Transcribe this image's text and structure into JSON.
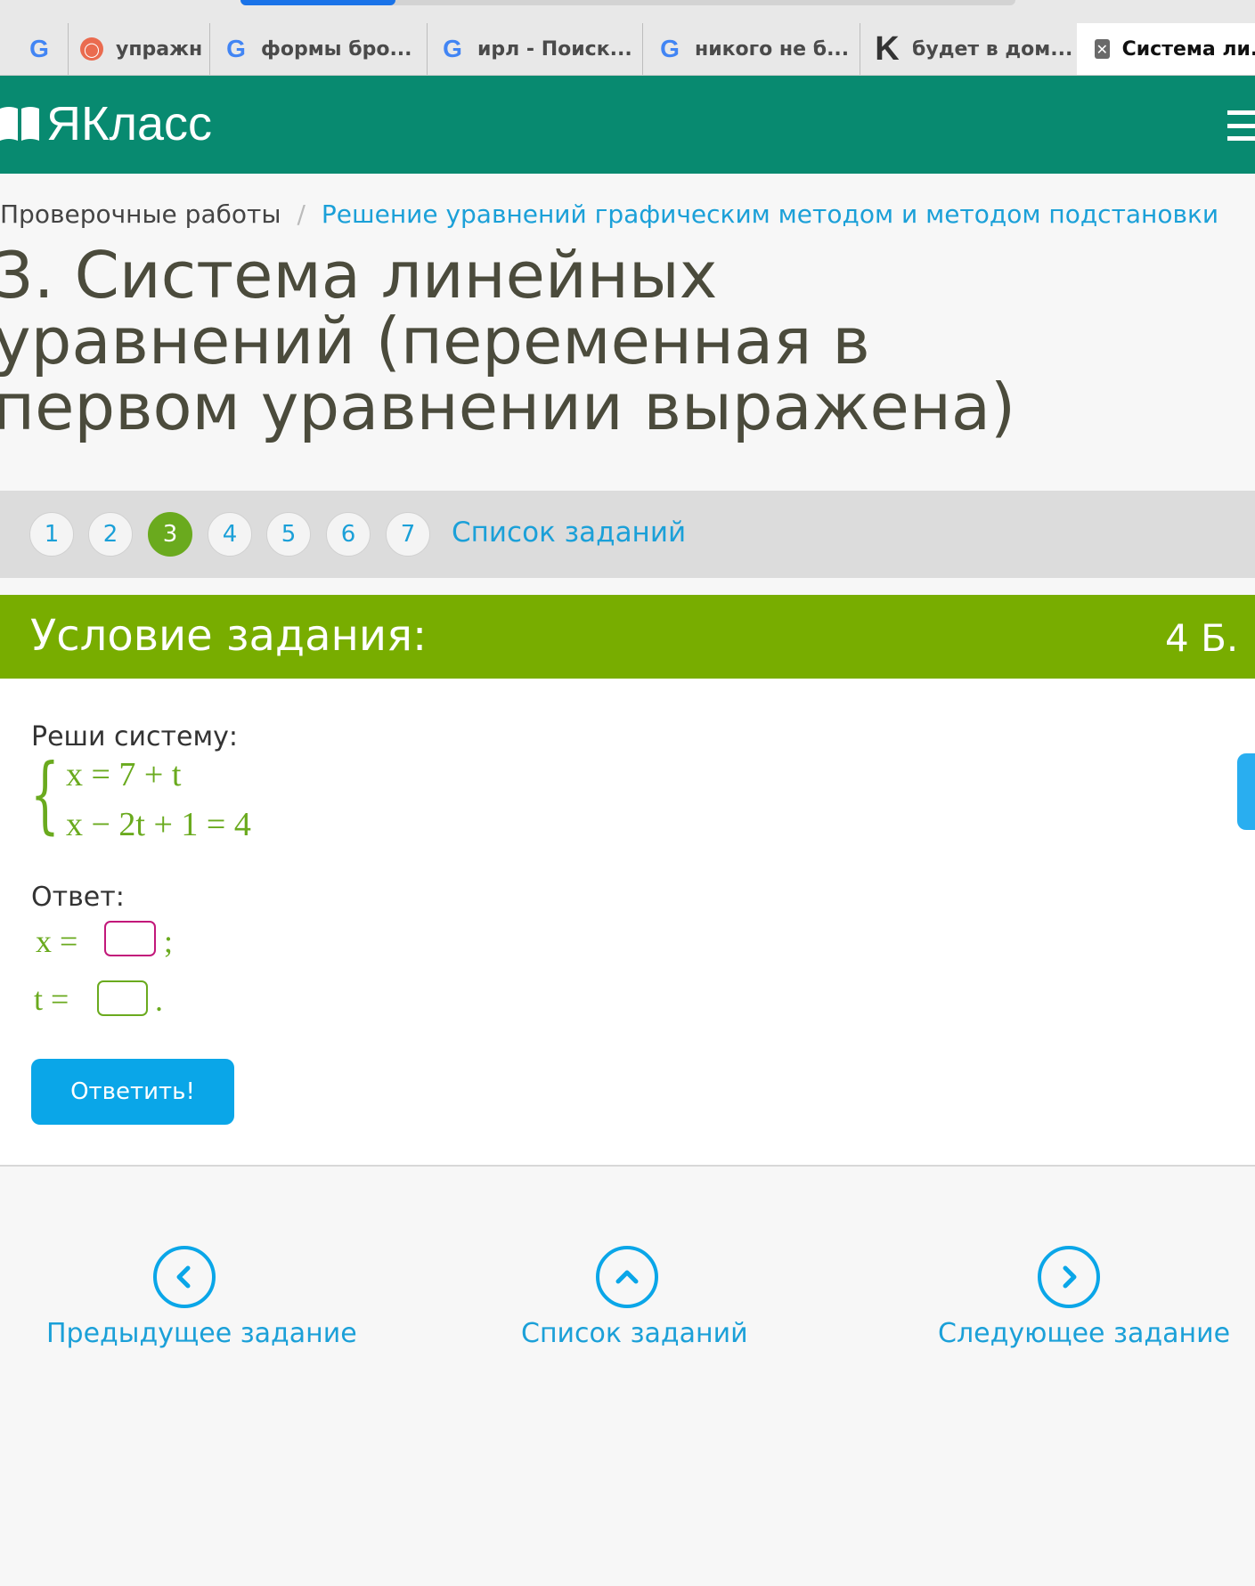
{
  "browser": {
    "tabs": [
      {
        "icon": "google-icon",
        "title": ""
      },
      {
        "icon": "basketball-icon",
        "title": "упражн"
      },
      {
        "icon": "google-icon",
        "title": "формы бро..."
      },
      {
        "icon": "google-icon",
        "title": "ирл - Поиск..."
      },
      {
        "icon": "google-icon",
        "title": "никого не б..."
      },
      {
        "icon": "k-icon",
        "title": "будет в дом..."
      },
      {
        "icon": "close-icon",
        "title": "Система ли..."
      }
    ],
    "page_load_progress": 0.2
  },
  "header": {
    "logo_text": "ЯКласс",
    "brand_color": "#088a70"
  },
  "breadcrumb": {
    "parent": "Проверочные работы",
    "separator": "/",
    "current": "Решение уравнений графическим методом и методом подстановки"
  },
  "page_title": "3. Система линейных уравнений (переменная в первом уравнении выражена)",
  "task_nav": {
    "numbers": [
      "1",
      "2",
      "3",
      "4",
      "5",
      "6",
      "7"
    ],
    "active": "3",
    "list_link": "Список заданий"
  },
  "condition": {
    "heading": "Условие задания:",
    "points": "4 Б.",
    "accent_color": "#78ad00",
    "prompt": "Реши систему:",
    "equations": [
      "x = 7 + t",
      "x − 2t + 1 = 4"
    ],
    "answer_label": "Ответ:",
    "x_label": "x =",
    "x_value": "",
    "x_punct": ";",
    "t_label": "t =",
    "t_value": "",
    "t_punct": ".",
    "submit_label": "Ответить!"
  },
  "bottom_nav": {
    "prev_label": "Предыдущее задание",
    "list_label": "Список заданий",
    "next_label": "Следующее задание",
    "link_color": "#1ba0d8"
  }
}
